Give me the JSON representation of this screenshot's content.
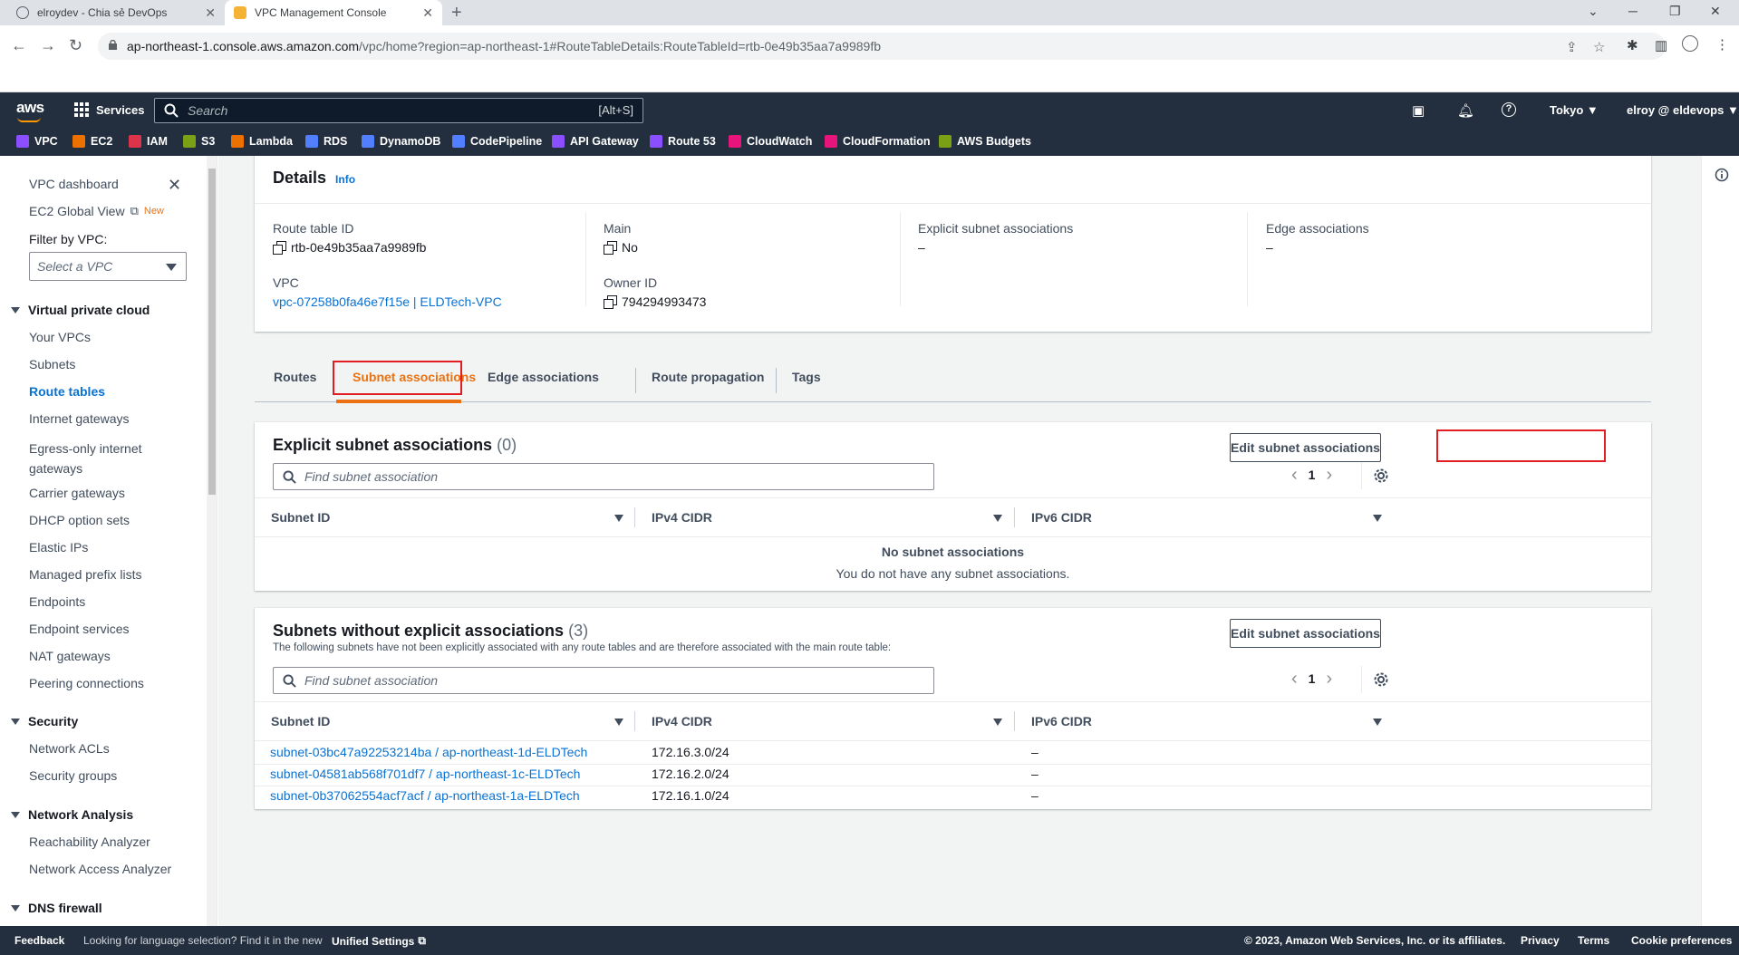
{
  "browser": {
    "tabs": [
      {
        "title": "elroydev - Chia sẻ DevOps"
      },
      {
        "title": "VPC Management Console"
      }
    ],
    "url_host": "ap-northeast-1.console.aws.amazon.com",
    "url_path": "/vpc/home?region=ap-northeast-1#RouteTableDetails:RouteTableId=rtb-0e49b35aa7a9989fb"
  },
  "aws_header": {
    "logo": "aws",
    "services_label": "Services",
    "search_placeholder": "Search",
    "search_shortcut": "[Alt+S]",
    "region": "Tokyo ▼",
    "account": "elroy @ eldevops ▼",
    "favorites": [
      {
        "label": "VPC",
        "color": "#8c4fff"
      },
      {
        "label": "EC2",
        "color": "#ed7100"
      },
      {
        "label": "IAM",
        "color": "#dd344c"
      },
      {
        "label": "S3",
        "color": "#7aa116"
      },
      {
        "label": "Lambda",
        "color": "#ed7100"
      },
      {
        "label": "RDS",
        "color": "#527fff"
      },
      {
        "label": "DynamoDB",
        "color": "#527fff"
      },
      {
        "label": "CodePipeline",
        "color": "#527fff"
      },
      {
        "label": "API Gateway",
        "color": "#8c4fff"
      },
      {
        "label": "Route 53",
        "color": "#8c4fff"
      },
      {
        "label": "CloudWatch",
        "color": "#e7157b"
      },
      {
        "label": "CloudFormation",
        "color": "#e7157b"
      },
      {
        "label": "AWS Budgets",
        "color": "#7aa116"
      }
    ]
  },
  "sidebar": {
    "dashboard": "VPC dashboard",
    "ec2_global_view": "EC2 Global View",
    "new_badge": "New",
    "filter_label": "Filter by VPC:",
    "filter_placeholder": "Select a VPC",
    "sections": [
      {
        "title": "Virtual private cloud",
        "items": [
          "Your VPCs",
          "Subnets",
          "Route tables",
          "Internet gateways",
          "Egress-only internet gateways",
          "Carrier gateways",
          "DHCP option sets",
          "Elastic IPs",
          "Managed prefix lists",
          "Endpoints",
          "Endpoint services",
          "NAT gateways",
          "Peering connections"
        ]
      },
      {
        "title": "Security",
        "items": [
          "Network ACLs",
          "Security groups"
        ]
      },
      {
        "title": "Network Analysis",
        "items": [
          "Reachability Analyzer",
          "Network Access Analyzer"
        ]
      },
      {
        "title": "DNS firewall",
        "items": []
      }
    ]
  },
  "details": {
    "title": "Details",
    "info": "Info",
    "route_table_id_label": "Route table ID",
    "route_table_id": "rtb-0e49b35aa7a9989fb",
    "main_label": "Main",
    "main_value": "No",
    "explicit_label": "Explicit subnet associations",
    "explicit_value": "–",
    "edge_label": "Edge associations",
    "edge_value": "–",
    "vpc_label": "VPC",
    "vpc_value": "vpc-07258b0fa46e7f15e | ELDTech-VPC",
    "owner_label": "Owner ID",
    "owner_value": "794294993473"
  },
  "tabs": [
    "Routes",
    "Subnet associations",
    "Edge associations",
    "Route propagation",
    "Tags"
  ],
  "explicit_section": {
    "title": "Explicit subnet associations",
    "count": "(0)",
    "button": "Edit subnet associations",
    "filter_placeholder": "Find subnet association",
    "page": "1",
    "columns": [
      "Subnet ID",
      "IPv4 CIDR",
      "IPv6 CIDR"
    ],
    "empty_title": "No subnet associations",
    "empty_desc": "You do not have any subnet associations."
  },
  "implicit_section": {
    "title": "Subnets without explicit associations",
    "count": "(3)",
    "description": "The following subnets have not been explicitly associated with any route tables and are therefore associated with the main route table:",
    "button": "Edit subnet associations",
    "filter_placeholder": "Find subnet association",
    "page": "1",
    "columns": [
      "Subnet ID",
      "IPv4 CIDR",
      "IPv6 CIDR"
    ],
    "rows": [
      {
        "subnet": "subnet-03bc47a92253214ba / ap-northeast-1d-ELDTech",
        "ipv4": "172.16.3.0/24",
        "ipv6": "–"
      },
      {
        "subnet": "subnet-04581ab568f701df7 / ap-northeast-1c-ELDTech",
        "ipv4": "172.16.2.0/24",
        "ipv6": "–"
      },
      {
        "subnet": "subnet-0b37062554acf7acf / ap-northeast-1a-ELDTech",
        "ipv4": "172.16.1.0/24",
        "ipv6": "–"
      }
    ]
  },
  "footer": {
    "feedback": "Feedback",
    "language_text": "Looking for language selection? Find it in the new",
    "unified_settings": "Unified Settings",
    "copyright": "© 2023, Amazon Web Services, Inc. or its affiliates.",
    "privacy": "Privacy",
    "terms": "Terms",
    "cookies": "Cookie preferences"
  }
}
